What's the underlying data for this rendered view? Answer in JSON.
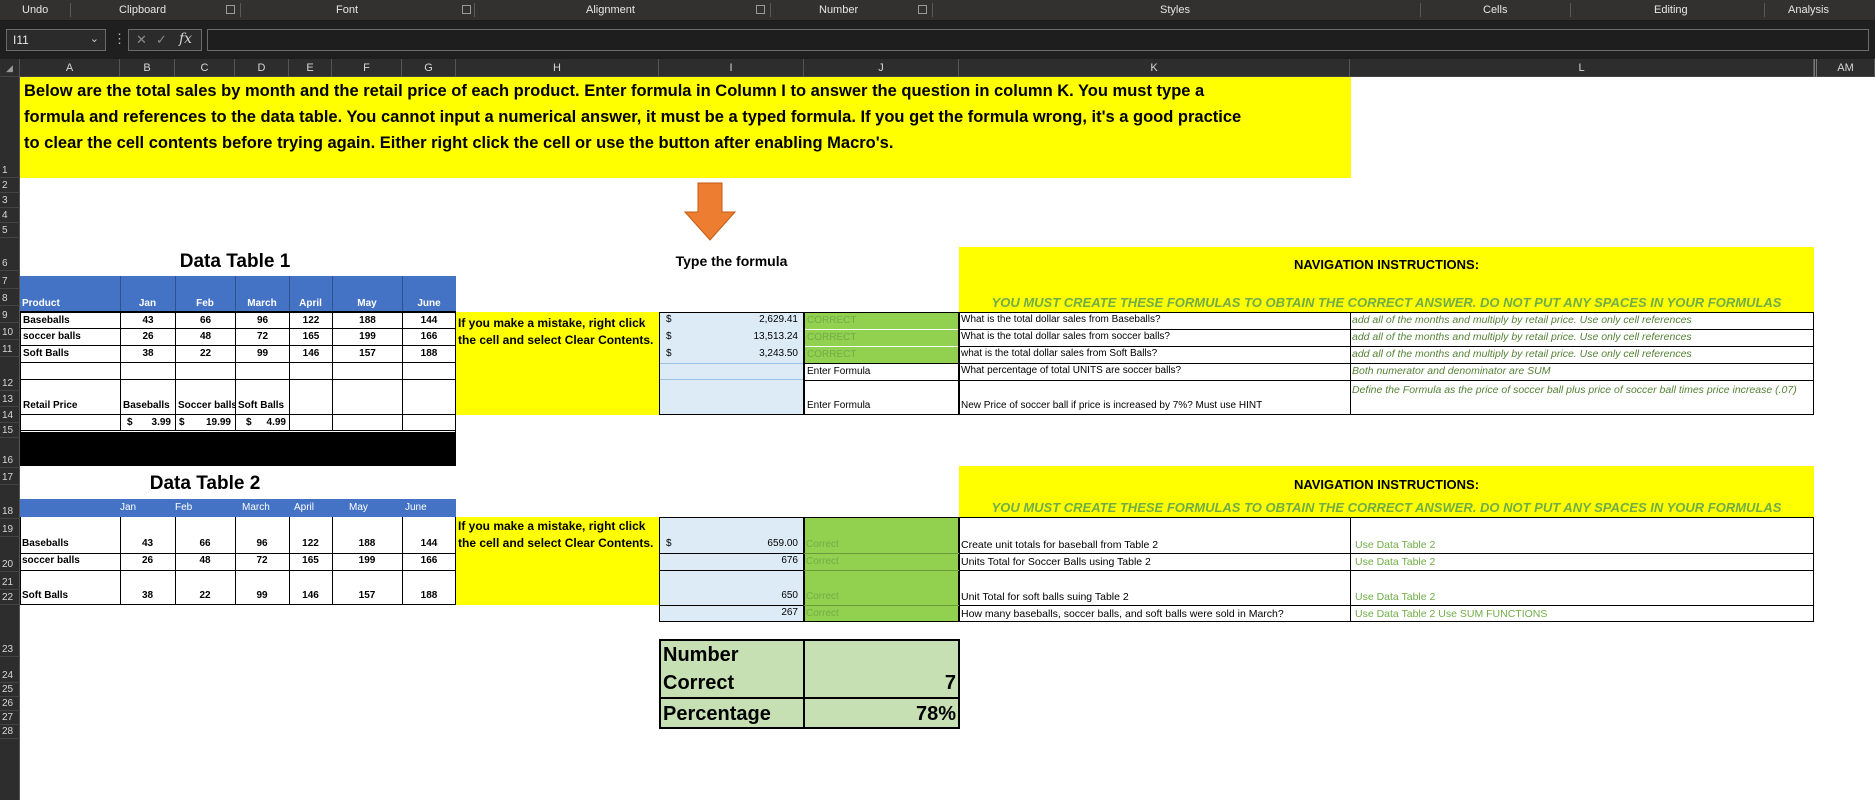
{
  "ribbon": {
    "groups": [
      "Undo",
      "Clipboard",
      "Font",
      "Alignment",
      "Number",
      "Styles",
      "Cells",
      "Editing",
      "Analysis"
    ]
  },
  "formula_bar": {
    "name_box": "I11",
    "fx_label": "fx",
    "cancel_glyph": "✕",
    "enter_glyph": "✓",
    "formula": ""
  },
  "columns": [
    "A",
    "B",
    "C",
    "D",
    "E",
    "F",
    "G",
    "H",
    "I",
    "J",
    "K",
    "L",
    "AM"
  ],
  "rows": [
    "1",
    "2",
    "3",
    "4",
    "5",
    "6",
    "7",
    "8",
    "9",
    "10",
    "11",
    "12",
    "13",
    "14",
    "15",
    "16",
    "17",
    "18",
    "19",
    "20",
    "21",
    "22",
    "23",
    "24",
    "25",
    "26",
    "27",
    "28"
  ],
  "instructions": {
    "line1": "Below are the total sales by month and the retail price of each product. Enter formula in Column I to answer the question in column K. You must type a",
    "line2": "formula and references to the data table. You cannot input a numerical answer, it must be a typed formula. If you get the formula wrong, it's a good practice",
    "line3": "to clear the cell contents before trying again. Either right click the cell or use the button after enabling Macro's."
  },
  "arrow_color": "#ed7d31",
  "table1": {
    "title": "Data Table 1",
    "headers": [
      "Product",
      "Jan",
      "Feb",
      "March",
      "April",
      "May",
      "June"
    ],
    "rows": [
      {
        "product": "Baseballs",
        "values": [
          "43",
          "66",
          "96",
          "122",
          "188",
          "144"
        ]
      },
      {
        "product": "soccer balls",
        "values": [
          "26",
          "48",
          "72",
          "165",
          "199",
          "166"
        ]
      },
      {
        "product": "Soft Balls",
        "values": [
          "38",
          "22",
          "99",
          "146",
          "157",
          "188"
        ]
      }
    ],
    "retail_label": "Retail Price",
    "price_headers": [
      "Baseballs",
      "Soccer balls",
      "Soft Balls"
    ],
    "price_currency": "$",
    "prices": [
      "3.99",
      "19.99",
      "4.99"
    ]
  },
  "table2": {
    "title": "Data Table 2",
    "headers": [
      "Jan",
      "Feb",
      "March",
      "April",
      "May",
      "June"
    ],
    "rows": [
      {
        "product": "Baseballs",
        "values": [
          "43",
          "66",
          "96",
          "122",
          "188",
          "144"
        ]
      },
      {
        "product": "soccer balls",
        "values": [
          "26",
          "48",
          "72",
          "165",
          "199",
          "166"
        ]
      },
      {
        "product": "Soft Balls",
        "values": [
          "38",
          "22",
          "99",
          "146",
          "157",
          "188"
        ]
      }
    ]
  },
  "mistake_note": {
    "line1": "If you make a mistake, right click",
    "line2": "the cell and select Clear Contents."
  },
  "type_formula_label": "Type the formula",
  "section1": {
    "nav_title": "NAVIGATION INSTRUCTIONS:",
    "must_create": "YOU MUST CREATE THESE FORMULAS TO OBTAIN THE CORRECT ANSWER. DO NOT PUT ANY SPACES IN YOUR FORMULAS",
    "answers": [
      {
        "currency": "$",
        "value": "2,629.41",
        "status": "CORRECT",
        "question": "What is the total dollar sales from Baseballs?",
        "hint": "add all of the months and multiply by retail price. Use only cell references"
      },
      {
        "currency": "$",
        "value": "13,513.24",
        "status": "CORRECT",
        "question": "What is the total dollar sales from soccer balls?",
        "hint": "add all of the months and multiply by retail price. Use only cell references"
      },
      {
        "currency": "$",
        "value": "3,243.50",
        "status": "CORRECT",
        "question": "what is the total  dollar sales from Soft Balls?",
        "hint": "add all of the months and multiply by retail price. Use only cell references"
      },
      {
        "currency": "",
        "value": "",
        "status": "Enter Formula",
        "question": "What percentage of total UNITS are soccer balls?",
        "hint": "Both numerator and denominator are SUM"
      },
      {
        "currency": "",
        "value": "",
        "status": "Enter Formula",
        "question": "New Price of soccer ball if price is increased by 7%? Must use HINT",
        "hint": "Define the Formula as the price of soccer ball plus price of soccer ball times price increase (.07)"
      }
    ]
  },
  "section2": {
    "nav_title": "NAVIGATION INSTRUCTIONS:",
    "must_create": "YOU MUST CREATE THESE FORMULAS TO OBTAIN THE CORRECT ANSWER. DO NOT PUT ANY SPACES IN YOUR FORMULAS",
    "answers": [
      {
        "currency": "$",
        "value": "659.00",
        "status": "Correct",
        "question": "Create unit totals for baseball  from Table 2",
        "hint": "Use Data Table 2"
      },
      {
        "currency": "",
        "value": "676",
        "status": "Correct",
        "question": "Units Total for Soccer Balls using Table 2",
        "hint": "Use Data Table 2"
      },
      {
        "currency": "",
        "value": "650",
        "status": "Correct",
        "question": "Unit Total for soft balls  suing Table 2",
        "hint": "Use Data Table 2"
      },
      {
        "currency": "",
        "value": "267",
        "status": "Correct",
        "question": "How many baseballs, soccer balls, and soft balls were sold in March?",
        "hint": "Use Data Table 2 Use SUM FUNCTIONS"
      }
    ]
  },
  "score": {
    "number_label": "Number",
    "correct_label": "Correct",
    "correct_count": "7",
    "percentage_label": "Percentage",
    "percentage": "78%"
  }
}
